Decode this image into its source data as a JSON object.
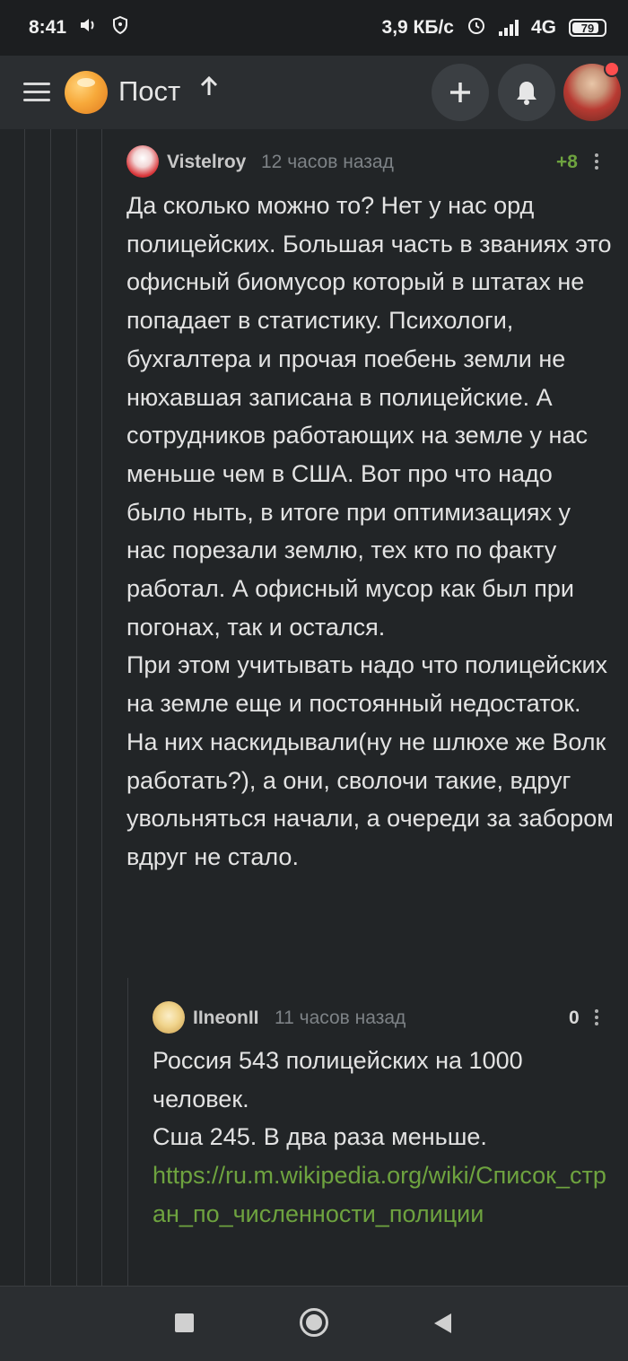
{
  "status_bar": {
    "time": "8:41",
    "speed": "3,9 КБ/с",
    "network": "4G",
    "battery": "79"
  },
  "header": {
    "title": "Пост",
    "icons": [
      "menu-icon",
      "pikabu-logo",
      "arrow-up-icon",
      "plus-icon",
      "bell-icon",
      "user-avatar"
    ]
  },
  "comments": [
    {
      "author": "Vistelroy",
      "time": "12 часов назад",
      "score": "+8",
      "score_color": "#6ea33f",
      "paragraphs": [
        "Да сколько можно то? Нет у нас орд полицейских. Большая часть в званиях это офисный биомусор который в штатах не попадает в статистику. Психологи, бухгалтера и прочая поебень земли не нюхавшая записана в полицейские. А сотрудников работающих на земле у нас меньше чем в США. Вот про что надо было ныть, в итоге при оптимизациях у нас порезали землю, тех кто по факту работал. А офисный мусор как был при погонах, так и остался.",
        "При этом учитывать надо что полицейских на земле еще и постоянный недостаток. На них наскидывали(ну не шлюхе же Волк работать?), а они, сволочи такие, вдруг увольняться начали, а очереди за забором вдруг не стало."
      ]
    },
    {
      "author": "IIneonII",
      "time": "11 часов назад",
      "score": "0",
      "score_color": "#d8d8d8",
      "paragraphs": [
        "Россия 543 полицейских на 1000 человек.",
        "Сша 245. В два раза меньше."
      ],
      "link": "https://ru.m.wikipedia.org/wiki/Список_стран_по_численности_полиции"
    }
  ],
  "colors": {
    "background": "#222527",
    "header_bg": "#2b2e31",
    "link": "#6ea33f",
    "accent_orange": "#f7a93a",
    "notification": "#ff4e4e"
  },
  "nav_bar": {
    "icons": [
      "recent-apps-icon",
      "home-icon",
      "back-icon"
    ]
  }
}
